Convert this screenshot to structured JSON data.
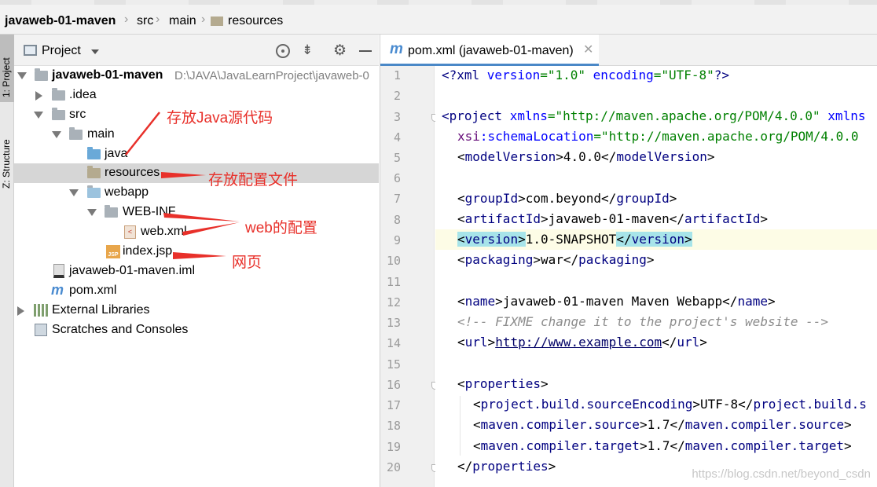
{
  "breadcrumb": {
    "project": "javaweb-01-maven",
    "p1": "src",
    "p2": "main",
    "p3": "resources"
  },
  "side_tabs": {
    "project": "1: Project",
    "structure": "Z: Structure"
  },
  "panel": {
    "title": "Project"
  },
  "tree": {
    "root_name": "javaweb-01-maven",
    "root_path": "D:\\JAVA\\JavaLearnProject\\javaweb-0",
    "idea": ".idea",
    "src": "src",
    "main": "main",
    "java": "java",
    "resources": "resources",
    "webapp": "webapp",
    "webinf": "WEB-INF",
    "webxml": "web.xml",
    "indexjsp": "index.jsp",
    "iml": "javaweb-01-maven.iml",
    "pom": "pom.xml",
    "libs": "External Libraries",
    "scratches": "Scratches and Consoles"
  },
  "editor": {
    "tab_label": "pom.xml (javaweb-01-maven)"
  },
  "annotations": {
    "java_src": "存放Java源代码",
    "res_cfg": "存放配置文件",
    "web_cfg": "web的配置",
    "page": "网页"
  },
  "line_numbers": [
    "1",
    "2",
    "3",
    "4",
    "5",
    "6",
    "7",
    "8",
    "9",
    "10",
    "11",
    "12",
    "13",
    "14",
    "15",
    "16",
    "17",
    "18",
    "19",
    "20"
  ],
  "code": {
    "l1_a": "<?xml ",
    "l1_b": "version",
    "l1_c": "=\"1.0\" ",
    "l1_d": "encoding",
    "l1_e": "=\"UTF-8\"",
    "l1_f": "?>",
    "l3_a": "<project ",
    "l3_b": "xmlns",
    "l3_c": "=\"http://maven.apache.org/POM/4.0.0\" ",
    "l3_d": "xmlns",
    "l4_a": "xsi",
    "l4_b": ":schemaLocation",
    "l4_c": "=\"http://maven.apache.org/POM/4.0.0",
    "modelVersion_tag": "modelVersion",
    "modelVersion_val": "4.0.0",
    "groupId_tag": "groupId",
    "groupId_val": "com.beyond",
    "artifactId_tag": "artifactId",
    "artifactId_val": "javaweb-01-maven",
    "version_tag": "version",
    "version_val": "1.0-SNAPSHOT",
    "packaging_tag": "packaging",
    "packaging_val": "war",
    "name_tag": "name",
    "name_val": "javaweb-01-maven Maven Webapp",
    "comment": "<!-- FIXME change it to the project's website -->",
    "url_tag": "url",
    "url_val": "http://www.example.com",
    "properties_tag": "properties",
    "enc_tag": "project.build.sourceEncoding",
    "enc_val": "UTF-8",
    "enc_close": "project.build.s",
    "src_tag": "maven.compiler.source",
    "src_val": "1.7",
    "tgt_tag": "maven.compiler.target",
    "tgt_val": "1.7"
  },
  "watermark": "https://blog.csdn.net/beyond_csdn",
  "colors": {
    "tag": "#000080",
    "attr": "#0000ff",
    "string": "#008000",
    "comment": "#8c8c8c",
    "annotation": "#e8302a",
    "selection": "#d6d6d6",
    "current_line": "#fdfce6",
    "tab_underline": "#4a88c7"
  }
}
